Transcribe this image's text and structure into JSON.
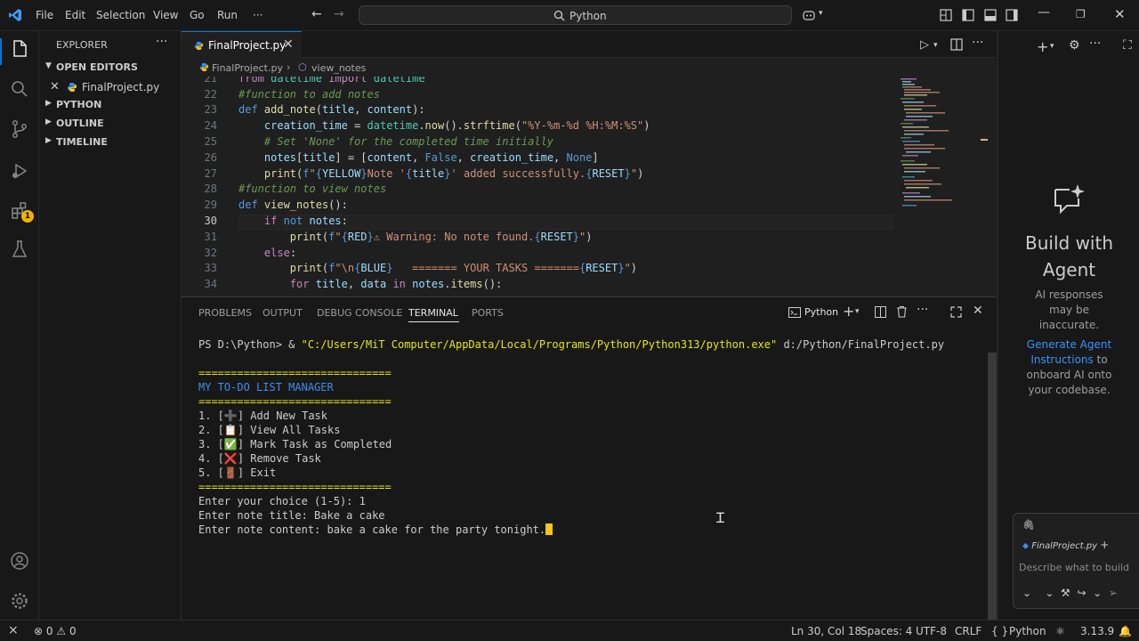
{
  "titlebar": {
    "menu": [
      "File",
      "Edit",
      "Selection",
      "View",
      "Go",
      "Run",
      "···"
    ],
    "search_text": "Python"
  },
  "sidebar": {
    "title": "EXPLORER",
    "more": "···",
    "open_editors_label": "OPEN EDITORS",
    "open_file": "FinalProject.py",
    "sections": [
      "PYTHON",
      "OUTLINE",
      "TIMELINE"
    ]
  },
  "activity": {
    "extensions_badge": "1"
  },
  "editor": {
    "tab_label": "FinalProject.py",
    "breadcrumb_file": "FinalProject.py",
    "breadcrumb_symbol": "view_notes",
    "line_numbers": [
      "21",
      "22",
      "23",
      "24",
      "25",
      "26",
      "27",
      "28",
      "29",
      "30",
      "31",
      "32",
      "33",
      "34"
    ],
    "current_line": "30"
  },
  "panel": {
    "tabs": [
      "PROBLEMS",
      "OUTPUT",
      "DEBUG CONSOLE",
      "TERMINAL",
      "PORTS"
    ],
    "active_tab": "TERMINAL",
    "terminal_profile": "Python",
    "terminal": {
      "prompt": "PS D:\\Python> & ",
      "exe_path": "\"C:/Users/MiT Computer/AppData/Local/Programs/Python/Python313/python.exe\"",
      "script_arg": " d:/Python/FinalProject.py",
      "rule": "==============================",
      "heading": "MY TO-DO LIST MANAGER",
      "menu_options": [
        {
          "num": "1. [",
          "icon": "➕",
          "label": "] Add New Task"
        },
        {
          "num": "2. [",
          "icon": "📋",
          "label": "] View All Tasks"
        },
        {
          "num": "3. [",
          "icon": "✅",
          "label": "] Mark Task as Completed"
        },
        {
          "num": "4. [",
          "icon": "❌",
          "label": "] Remove Task"
        },
        {
          "num": "5. [",
          "icon": "🚪",
          "label": "] Exit"
        }
      ],
      "input_choice": "Enter your choice (1-5): 1",
      "input_title": "Enter note title: Bake a cake",
      "input_content": "Enter note content: bake a cake for the party tonight."
    }
  },
  "chat": {
    "title": "Build with Agent",
    "disclaimer": "AI responses may be inaccurate.",
    "link": "Generate Agent Instructions",
    "link_suffix": " to onboard AI onto your codebase.",
    "context_file": "FinalProject.py",
    "input_placeholder": "Describe what to build"
  },
  "statusbar": {
    "errors": "0",
    "warnings": "0",
    "position": "Ln 30, Col 18",
    "spaces": "Spaces: 4",
    "encoding": "UTF-8",
    "eol": "CRLF",
    "braces": "{ }",
    "language": "Python",
    "interpreter": "3.13.9"
  },
  "colors": {
    "accent": "#0078d4",
    "terminal_yellow": "#e5e510",
    "terminal_blue": "#3b8eea",
    "badge": "#f0b400"
  }
}
